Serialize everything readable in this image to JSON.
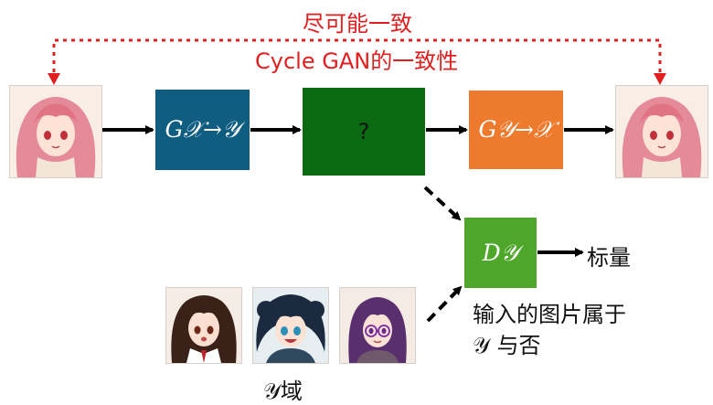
{
  "top_label": "尽可能一致",
  "cycle_label": "Cycle GAN的一致性",
  "boxes": {
    "g_xy": "G𝒳→𝒴",
    "middle": "?",
    "g_yx": "G𝒴→𝒳",
    "discriminator": "D𝒴"
  },
  "output_label": "标量",
  "decision_line1": "输入的图片属于",
  "decision_line2": "𝒴 与否",
  "domain_caption": "𝒴域",
  "icons": [
    "anime-girl-pink-hair-input",
    "anime-girl-pink-hair-reconstruction",
    "anime-girl-brown-hair-sample",
    "anime-girl-blue-hair-sample",
    "anime-girl-purple-hair-glasses-sample"
  ],
  "colors": {
    "dotted_line": "#e02020",
    "g_xy_box": "#0f5e82",
    "middle_box": "#0b6a12",
    "g_yx_box": "#ee7a2e",
    "discriminator_box": "#4ea62a"
  }
}
